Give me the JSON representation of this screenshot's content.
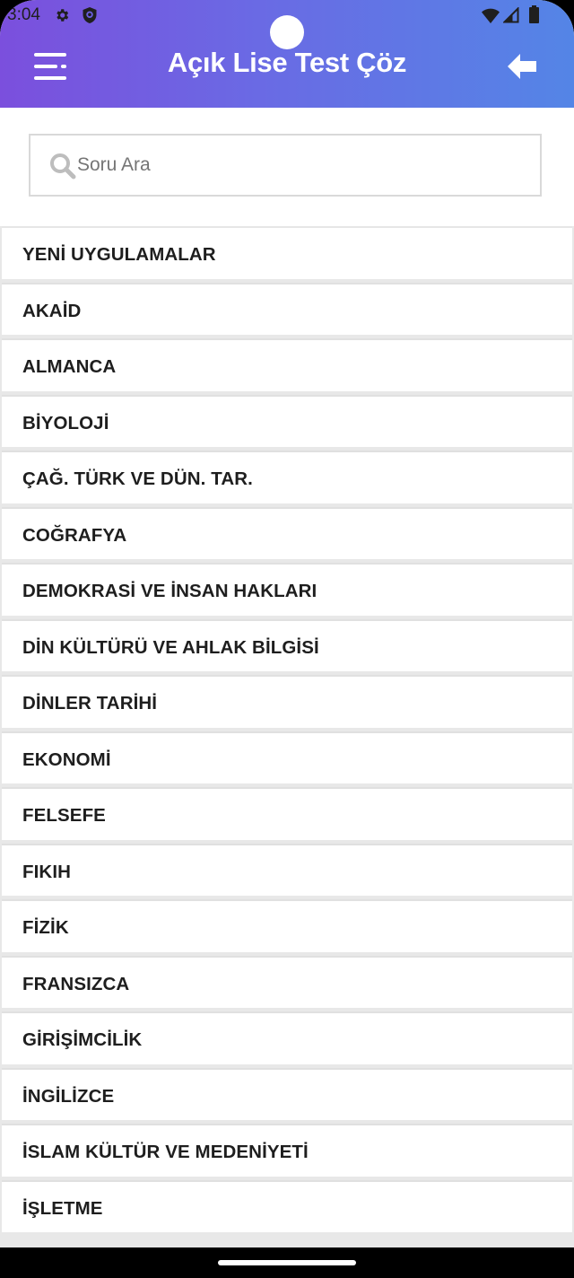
{
  "status_bar": {
    "time": "3:04",
    "icons": [
      "gear-icon",
      "shield-icon",
      "wifi-icon",
      "signal-icon",
      "battery-icon"
    ]
  },
  "header": {
    "title": "Açık Lise Test Çöz",
    "menu_icon": "menu-icon",
    "back_icon": "back-arrow-icon",
    "gradient": [
      "#7b4fdd",
      "#5485e6"
    ]
  },
  "search": {
    "placeholder": "Soru Ara",
    "value": "",
    "icon": "search-icon"
  },
  "subjects": [
    {
      "label": "YENİ UYGULAMALAR"
    },
    {
      "label": "AKAİD"
    },
    {
      "label": "ALMANCA"
    },
    {
      "label": "BİYOLOJİ"
    },
    {
      "label": "ÇAĞ. TÜRK VE DÜN. TAR."
    },
    {
      "label": "COĞRAFYA"
    },
    {
      "label": "DEMOKRASİ VE İNSAN HAKLARI"
    },
    {
      "label": "DİN KÜLTÜRÜ VE AHLAK BİLGİSİ"
    },
    {
      "label": "DİNLER TARİHİ"
    },
    {
      "label": "EKONOMİ"
    },
    {
      "label": "FELSEFE"
    },
    {
      "label": "FIKIH"
    },
    {
      "label": "FİZİK"
    },
    {
      "label": "FRANSIZCA"
    },
    {
      "label": "GİRİŞİMCİLİK"
    },
    {
      "label": "İNGİLİZCE"
    },
    {
      "label": "İSLAM KÜLTÜR VE MEDENİYETİ"
    },
    {
      "label": "İŞLETME"
    }
  ]
}
